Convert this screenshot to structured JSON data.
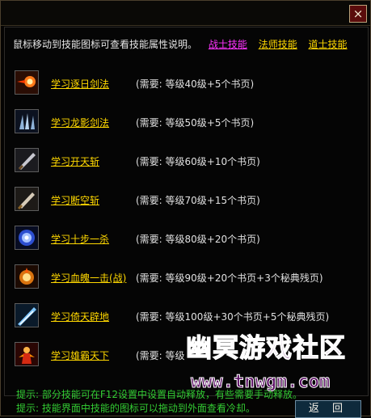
{
  "dialog": {
    "close_symbol": "×",
    "intro_text": "鼠标移动到技能图标可查看技能属性说明。",
    "tabs": [
      {
        "label": "战士技能",
        "color": "#ff33ff"
      },
      {
        "label": "法师技能",
        "color": "#ffd800"
      },
      {
        "label": "道士技能",
        "color": "#ffd800"
      }
    ]
  },
  "skills": [
    {
      "name": "学习逐日剑法",
      "requirement": "(需要: 等级40级+5个书页)",
      "icon": "sun-sword-icon"
    },
    {
      "name": "学习龙影剑法",
      "requirement": "(需要: 等级50级+5个书页)",
      "icon": "dragon-shadow-icon"
    },
    {
      "name": "学习开天斩",
      "requirement": "(需要: 等级60级+10个书页)",
      "icon": "heaven-slash-icon"
    },
    {
      "name": "学习断空斩",
      "requirement": "(需要: 等级70级+15个书页)",
      "icon": "void-slash-icon"
    },
    {
      "name": "学习十步一杀",
      "requirement": "(需要: 等级80级+20个书页)",
      "icon": "ten-step-kill-icon"
    },
    {
      "name": "学习血魄一击(战)",
      "requirement": "(需要: 等级90级+20个书页+3个秘典残页)",
      "icon": "blood-strike-icon"
    },
    {
      "name": "学习倚天辟地",
      "requirement": "(需要: 等级100级+30个书页+5个秘典残页)",
      "icon": "sky-split-icon"
    },
    {
      "name": "学习雄霸天下",
      "requirement": "(需要: 等级",
      "icon": "overlord-icon"
    }
  ],
  "tips": [
    "提示: 部分技能可在F12设置中设置自动释放，有些需要手动释放。",
    "提示: 技能界面中技能的图标可以拖动到外面查看冷却。"
  ],
  "back_label": "返 回",
  "watermark": {
    "title": "幽冥游戏社区",
    "url": "www.tnwgm.com"
  }
}
